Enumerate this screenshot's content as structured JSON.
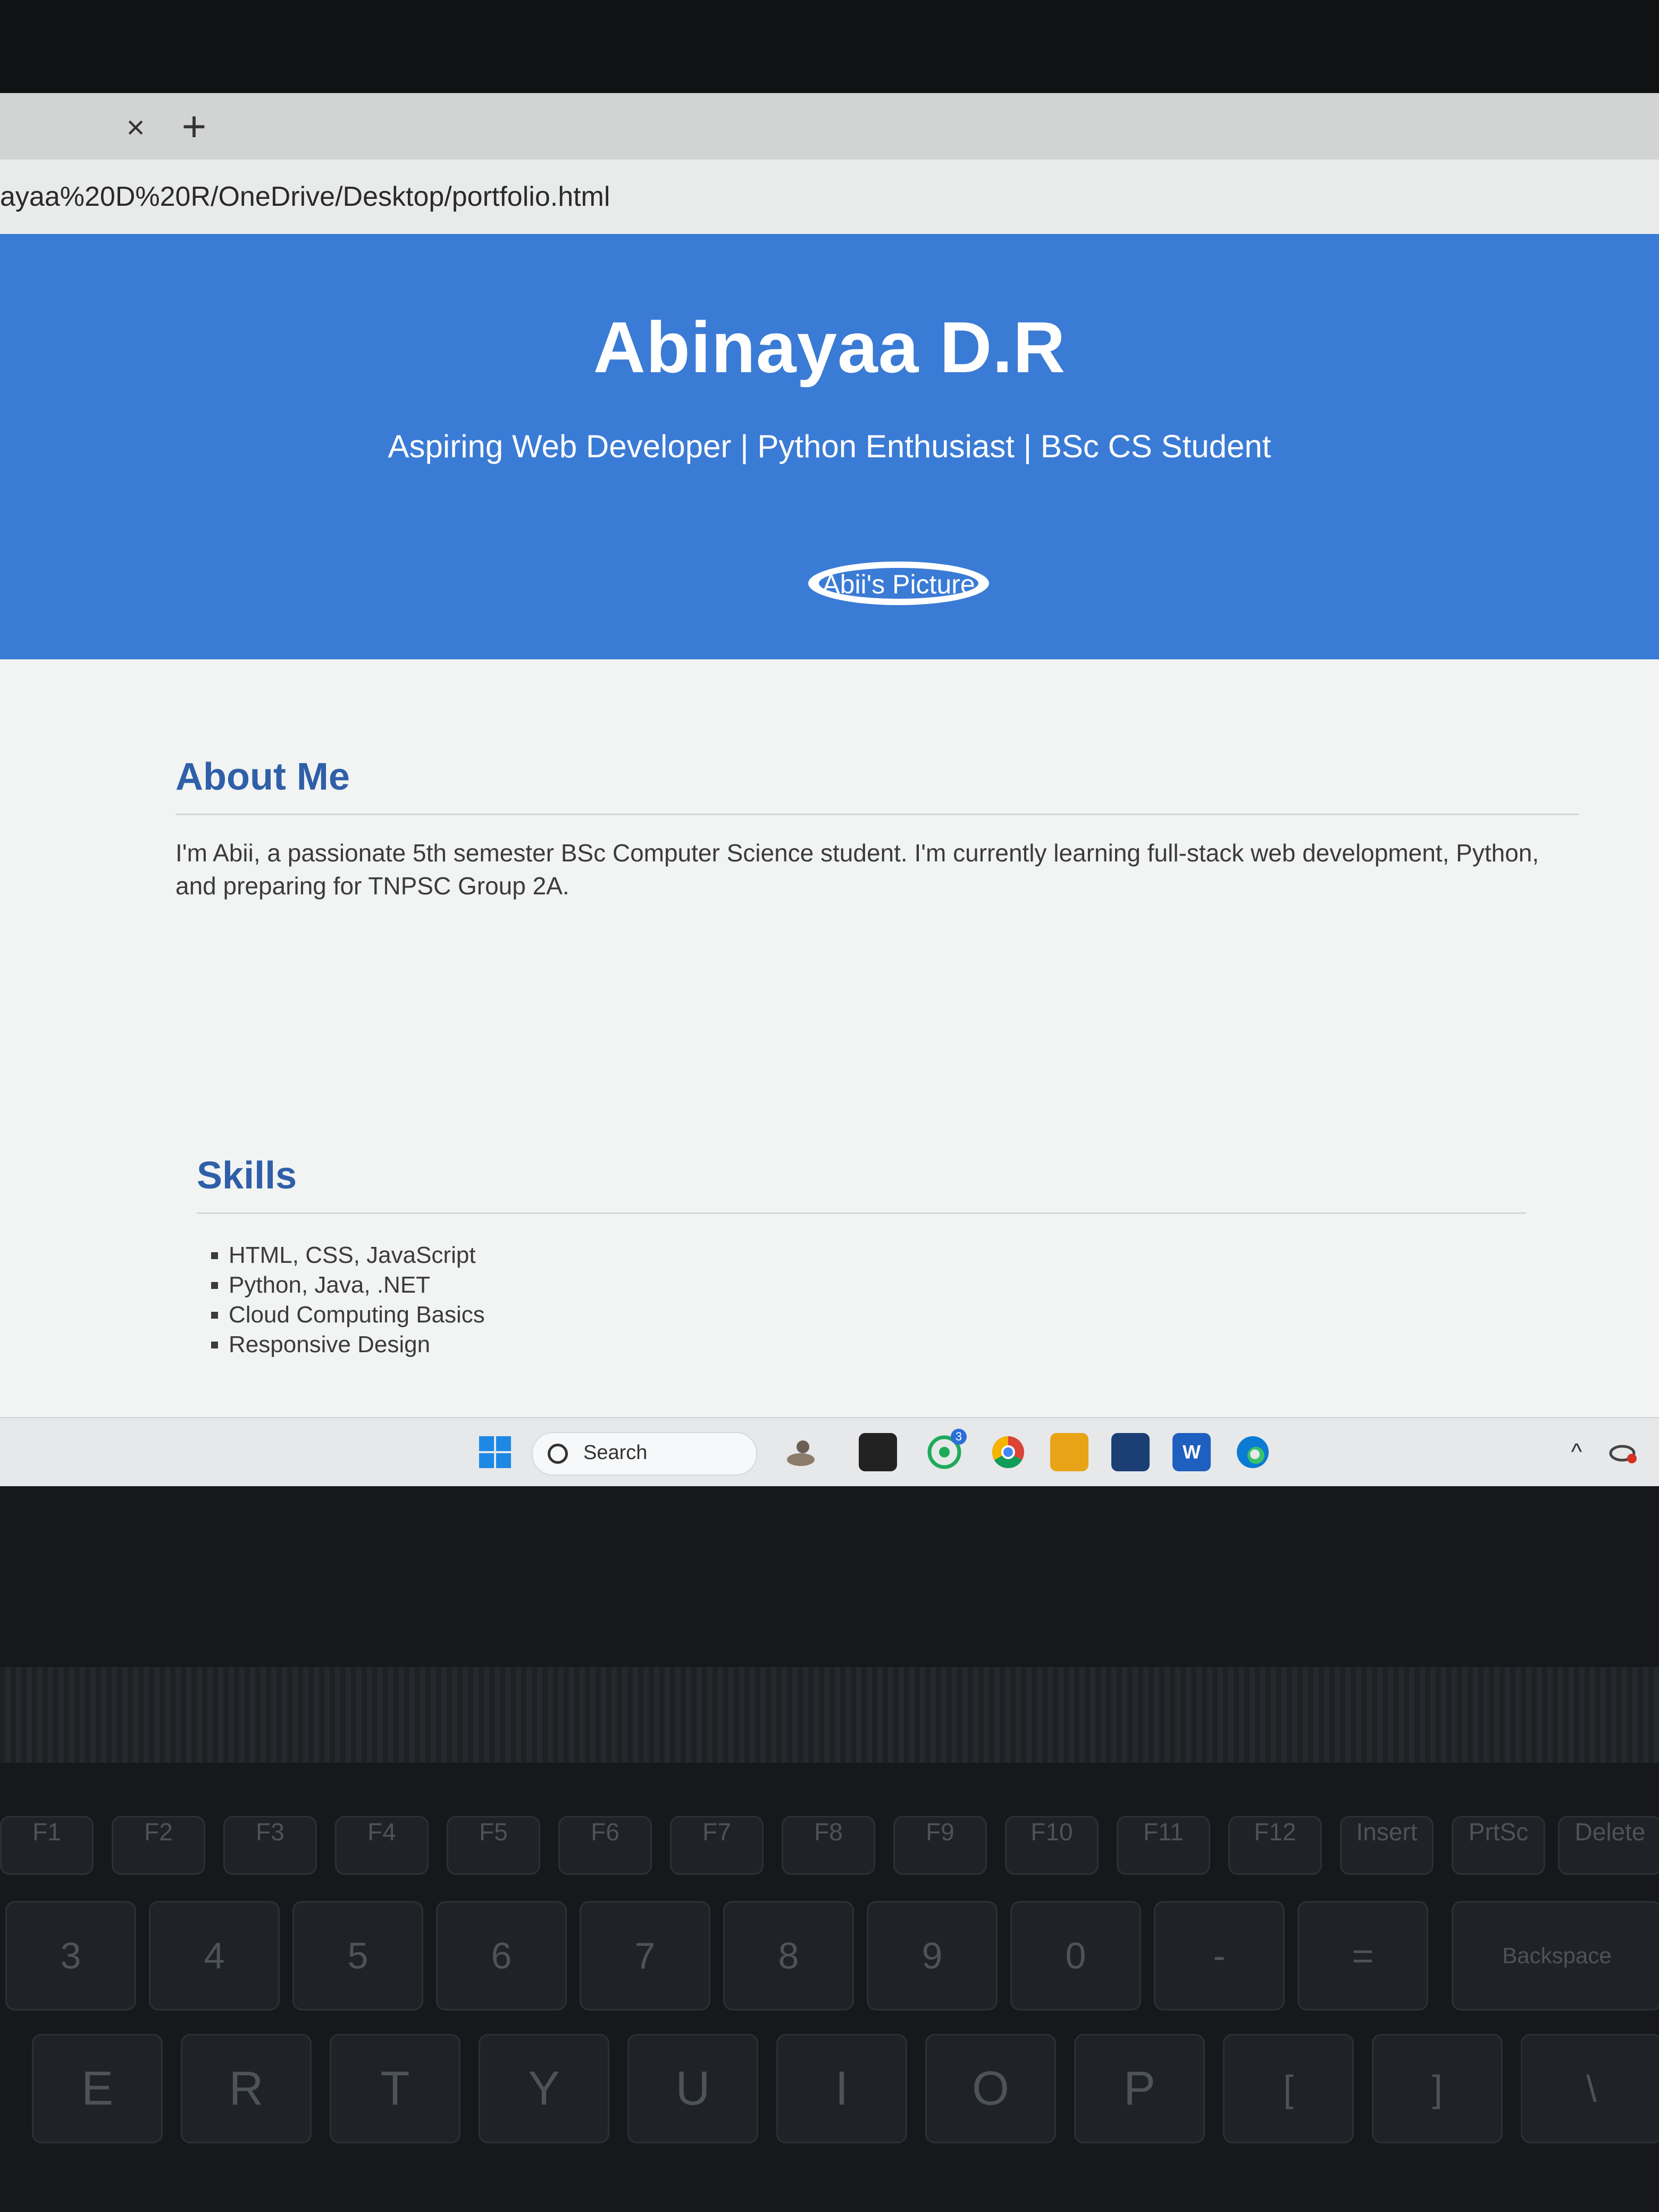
{
  "browser": {
    "tab_close": "×",
    "new_tab": "+",
    "url": "ayaa%20D%20R/OneDrive/Desktop/portfolio.html"
  },
  "header": {
    "name": "Abinayaa D.R",
    "tagline": "Aspiring Web Developer | Python Enthusiast | BSc CS Student",
    "picture_alt": "Abii's Picture"
  },
  "about": {
    "title": "About Me",
    "text": "I'm Abii, a passionate 5th semester BSc Computer Science student. I'm currently learning full-stack web development, Python, and preparing for TNPSC Group 2A."
  },
  "skills": {
    "title": "Skills",
    "items": [
      "HTML, CSS, JavaScript",
      "Python, Java, .NET",
      "Cloud Computing Basics",
      "Responsive Design"
    ]
  },
  "taskbar": {
    "search_label": "Search",
    "whatsapp_badge": "3",
    "word_label": "W",
    "apps": [
      "start-icon",
      "search-icon",
      "widgets-icon",
      "file-app-icon",
      "whatsapp-icon",
      "chrome-icon",
      "file-explorer-icon",
      "store-icon",
      "word-icon",
      "edge-icon"
    ]
  },
  "keyboard": {
    "fkeys": [
      "F1",
      "F2",
      "F3",
      "F4",
      "F5",
      "F6",
      "F7",
      "F8",
      "F9",
      "F10",
      "F11",
      "F12",
      "Insert",
      "PrtSc",
      "Delete"
    ],
    "number_row": [
      "3",
      "4",
      "5",
      "6",
      "7",
      "8",
      "9",
      "0",
      "-",
      "=",
      "Backspace"
    ],
    "letter_row": [
      "E",
      "R",
      "T",
      "Y",
      "U",
      "I",
      "O",
      "P",
      "[",
      "]",
      "\\"
    ]
  },
  "colors": {
    "header_bg": "#3a7bd5",
    "section_title": "#2f5fa8"
  }
}
